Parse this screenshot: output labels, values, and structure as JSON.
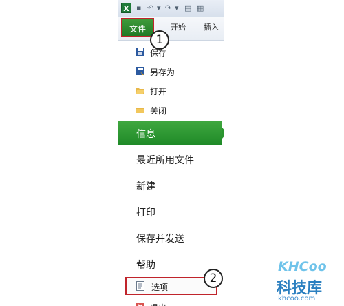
{
  "ribbon": {
    "file_tab": "文件",
    "tabs": [
      "开始",
      "插入"
    ]
  },
  "callouts": [
    "1",
    "2"
  ],
  "backstage": {
    "small_items": [
      {
        "label": "保存",
        "icon": "save-icon"
      },
      {
        "label": "另存为",
        "icon": "save-as-icon"
      },
      {
        "label": "打开",
        "icon": "open-folder-icon"
      },
      {
        "label": "关闭",
        "icon": "close-folder-icon"
      }
    ],
    "selected": "信息",
    "big_items": [
      "最近所用文件",
      "新建",
      "打印",
      "保存并发送",
      "帮助"
    ],
    "options": {
      "label": "选项",
      "icon": "options-icon"
    },
    "exit_partial": "退出"
  },
  "watermark": {
    "logo": "KHCoo",
    "cn": "科技库",
    "url": "khcoo.com"
  },
  "colors": {
    "accent_green": "#2b952f",
    "highlight_red": "#c0242b"
  }
}
